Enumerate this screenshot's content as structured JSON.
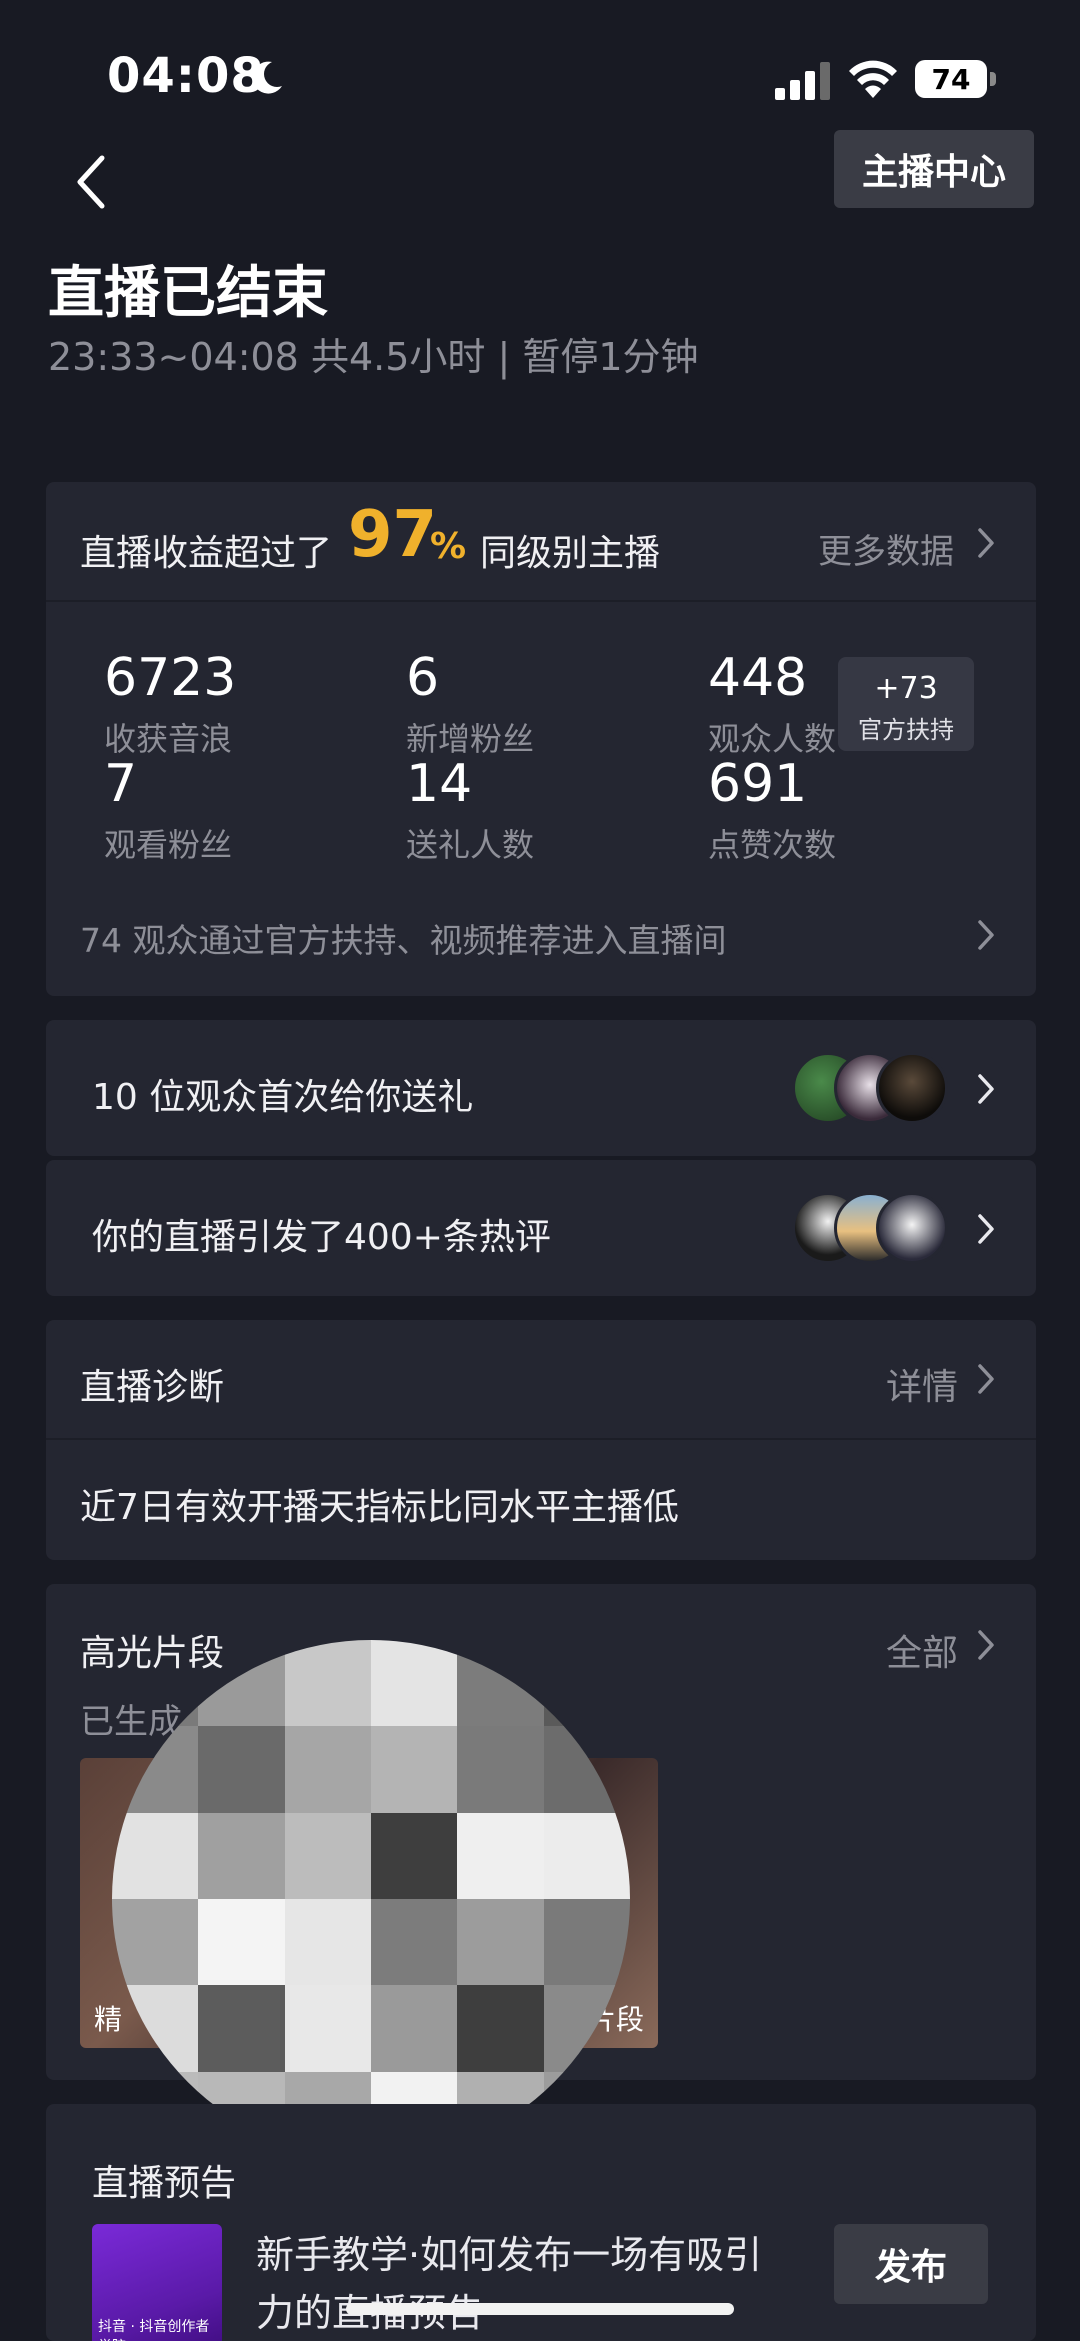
{
  "status_bar": {
    "time": "04:08",
    "battery": "74"
  },
  "header": {
    "streamer_center_label": "主播中心",
    "title": "直播已结束",
    "subtitle": "23:33~04:08 共4.5小时 | 暂停1分钟"
  },
  "revenue": {
    "prefix": "直播收益超过了",
    "percent": "97",
    "percent_sign": "%",
    "suffix": "同级别主播",
    "more_label": "更多数据",
    "stats": [
      {
        "value": "6723",
        "label": "收获音浪"
      },
      {
        "value": "6",
        "label": "新增粉丝"
      },
      {
        "value": "448",
        "label": "观众人数"
      },
      {
        "value": "7",
        "label": "观看粉丝"
      },
      {
        "value": "14",
        "label": "送礼人数"
      },
      {
        "value": "691",
        "label": "点赞次数"
      }
    ],
    "support_badge": {
      "value": "+73",
      "label": "官方扶持"
    },
    "viewers_note": "74 观众通过官方扶持、视频推荐进入直播间"
  },
  "gifts_row": {
    "label": "10 位观众首次给你送礼"
  },
  "comments_row": {
    "label": "你的直播引发了400+条热评"
  },
  "diagnosis": {
    "title": "直播诊断",
    "detail_label": "详情",
    "message": "近7日有效开播天指标比同水平主播低"
  },
  "highlights": {
    "title": "高光片段",
    "all_label": "全部",
    "generated": "已生成",
    "thumb_left_label": "精",
    "thumb_right_label": "片段"
  },
  "preview": {
    "title": "直播预告",
    "thumb_text": "抖音 · 抖音创作者学院",
    "description": "新手教学·如何发布一场有吸引力的直播预告",
    "publish_label": "发布"
  },
  "colors": {
    "accent": "#f0b12c",
    "background": "#181a23",
    "card": "#242631"
  }
}
